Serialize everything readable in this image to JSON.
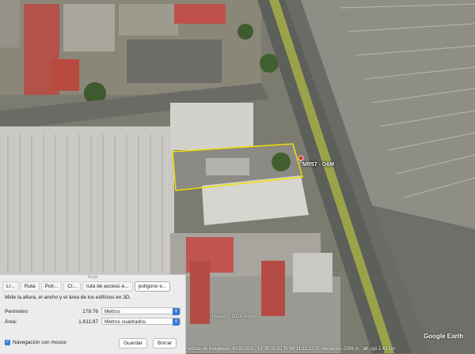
{
  "map": {
    "pin_label": "MR57 - G6M",
    "copyright": "Image © 2024 Airbus",
    "logo": "Google Earth",
    "status": {
      "date": "Fechas de imágenes: 4/18/2023",
      "coords": "19°39'32.81\"N  99°11'12.12\"O",
      "elevation": "elevación  2256 m",
      "altitude": "alt. ojo  2.43 km"
    },
    "colors": {
      "highlight": "#f0e000",
      "pin": "#d83030"
    }
  },
  "ruler": {
    "title": "Regla",
    "tabs": [
      "Lí...",
      "Ruta",
      "Polí...",
      "Cí...",
      "ruta de acceso e...",
      "polígono e..."
    ],
    "active_tab_index": 5,
    "description": "Mide la altura, el ancho y el área de los edificios en 3D.",
    "perimeter": {
      "label": "Perímetro:",
      "value": "179.76",
      "unit": "Metros"
    },
    "area": {
      "label": "Área:",
      "value": "1,611.97",
      "unit": "Metros cuadrados"
    },
    "mouse_nav": "Navegación con mouse",
    "save": "Guardar",
    "clear": "Borrar"
  }
}
